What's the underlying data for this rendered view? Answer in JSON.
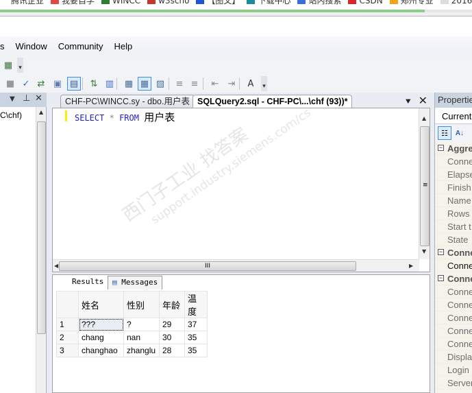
{
  "browser": {
    "bookmarks": [
      {
        "label": "腾讯企业",
        "icon": "bookmark-icon",
        "color": "#ffffff"
      },
      {
        "label": "我要自学",
        "icon": "bookmark-icon",
        "color": "#e04848"
      },
      {
        "label": "WINCC",
        "icon": "bookmark-icon",
        "color": "#2e7d32"
      },
      {
        "label": "w3scho",
        "icon": "bookmark-icon",
        "color": "#c0392b"
      },
      {
        "label": "【图文】",
        "icon": "bookmark-icon",
        "color": "#1f55d6"
      },
      {
        "label": "下载中心",
        "icon": "bookmark-icon",
        "color": "#1b8a9a"
      },
      {
        "label": "站内搜索",
        "icon": "bookmark-icon",
        "color": "#3b6fd1"
      },
      {
        "label": "CSDN",
        "icon": "bookmark-icon",
        "color": "#d7262e"
      },
      {
        "label": "郑州专业",
        "icon": "bookmark-icon",
        "color": "#f2a31b"
      },
      {
        "label": "2016",
        "icon": "page-icon",
        "color": "#dddddd"
      }
    ],
    "load_progress_percent": 90
  },
  "menu": {
    "items": [
      "s",
      "Window",
      "Community",
      "Help"
    ]
  },
  "toolbar": {
    "icons": [
      "stop-icon",
      "parse-check-icon",
      "query-designer-icon",
      "specify-values-icon",
      "results-to-text-icon",
      "display-plan-icon",
      "client-statistics-icon",
      "results-to-text-alt-icon",
      "results-to-grid-icon",
      "results-to-file-icon",
      "comment-icon",
      "uncomment-icon",
      "decrease-indent-icon",
      "increase-indent-icon",
      "specify-template-icon"
    ]
  },
  "left_panel": {
    "tree_item": "C\\chf)"
  },
  "editor": {
    "tabs": [
      {
        "label": "CHF-PC\\WINCC.sy - dbo.用户表",
        "active": false
      },
      {
        "label": "SQLQuery2.sql - CHF-PC\\...\\chf (93))*",
        "active": true
      }
    ],
    "code": {
      "kw1": "SELECT",
      "op": "*",
      "kw2": "FROM",
      "table": "用户表"
    }
  },
  "results": {
    "tabs": [
      "Results",
      "Messages"
    ],
    "columns": [
      "姓名",
      "性别",
      "年龄",
      "温度"
    ],
    "rows": [
      {
        "n": "1",
        "cells": [
          "???",
          "?",
          "29",
          "37"
        ]
      },
      {
        "n": "2",
        "cells": [
          "chang",
          "nan",
          "30",
          "35"
        ]
      },
      {
        "n": "3",
        "cells": [
          "changhao",
          "zhanglu",
          "28",
          "35"
        ]
      }
    ]
  },
  "properties": {
    "title": "Propertie",
    "object": "Current",
    "rows": [
      {
        "label": "Aggre",
        "type": "cat"
      },
      {
        "label": "Conne",
        "type": "prop"
      },
      {
        "label": "Elapse",
        "type": "prop"
      },
      {
        "label": "Finish",
        "type": "prop"
      },
      {
        "label": "Name",
        "type": "prop"
      },
      {
        "label": "Rows",
        "type": "prop"
      },
      {
        "label": "Start t",
        "type": "prop"
      },
      {
        "label": "State",
        "type": "prop"
      },
      {
        "label": "Conne",
        "type": "cat"
      },
      {
        "label": "Conne",
        "type": "dark"
      },
      {
        "label": "Conne",
        "type": "cat"
      },
      {
        "label": "Conne",
        "type": "prop"
      },
      {
        "label": "Conne",
        "type": "prop"
      },
      {
        "label": "Conne",
        "type": "prop"
      },
      {
        "label": "Conne",
        "type": "prop"
      },
      {
        "label": "Conne",
        "type": "prop"
      },
      {
        "label": "Displa",
        "type": "prop"
      },
      {
        "label": "Login",
        "type": "prop"
      },
      {
        "label": "Server",
        "type": "prop"
      }
    ]
  },
  "watermark": {
    "line1": "西门子工业  找答案",
    "line2": "support.industry.siemens.com/cs"
  }
}
